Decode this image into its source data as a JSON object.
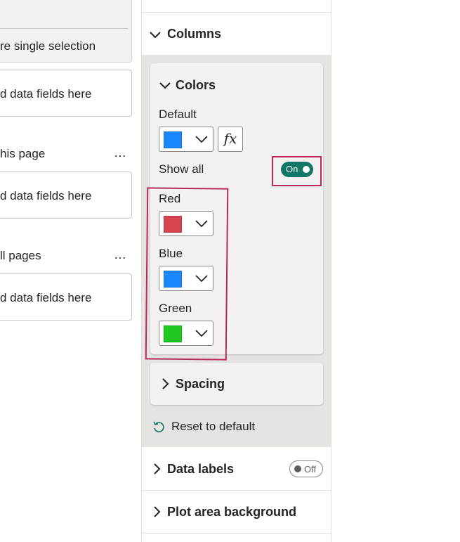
{
  "filters_pane": {
    "selection_option_text": "re single selection",
    "visual_filters_drop_text": "d data fields here",
    "page_section_label": "his page",
    "page_filters_drop_text": "d data fields here",
    "all_pages_section_label": "ll pages",
    "all_pages_drop_text": "d data fields here",
    "more_options": "…"
  },
  "format_pane": {
    "columns": {
      "title": "Columns",
      "expanded": true,
      "colors_card": {
        "title": "Colors",
        "default_label": "Default",
        "default_color": "#1a86ff",
        "fx_label": "fx",
        "show_all_label": "Show all",
        "show_all_toggle": "On",
        "series": [
          {
            "label": "Red",
            "color": "#d6454f"
          },
          {
            "label": "Blue",
            "color": "#1a86ff"
          },
          {
            "label": "Green",
            "color": "#1ec81e"
          }
        ]
      },
      "spacing_card": {
        "title": "Spacing"
      },
      "reset_label": "Reset to default"
    },
    "data_labels": {
      "title": "Data labels",
      "toggle": "Off"
    },
    "plot_area_background": {
      "title": "Plot area background"
    }
  },
  "colors": {
    "highlight_border": "#b8285a",
    "toggle_on": "#117865",
    "pane_bg": "#e6e4e1",
    "card_bg": "#f3f2f1"
  },
  "icons": {
    "chevron_down": "chevron-down-icon",
    "chevron_right": "chevron-right-icon",
    "reset": "reset-icon"
  }
}
